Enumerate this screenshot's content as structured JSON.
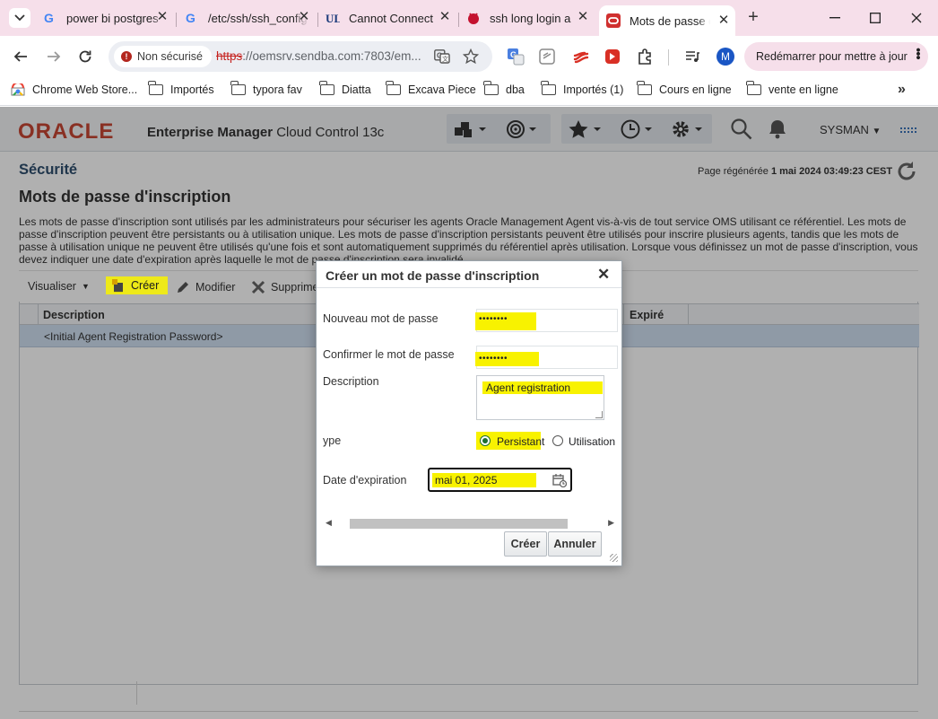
{
  "tabs": [
    {
      "title": "power bi postgres",
      "icon": "google-icon"
    },
    {
      "title": "/etc/ssh/ssh_config",
      "icon": "google-icon"
    },
    {
      "title": "Cannot Connect",
      "icon": "ul-icon"
    },
    {
      "title": "ssh long login a",
      "icon": "debian-icon"
    },
    {
      "title": "Mots de passe d",
      "icon": "oracle-icon",
      "active": true
    }
  ],
  "toolbar": {
    "security_chip": "Non sécurisé",
    "url_scheme": "https",
    "url_rest": "://oemsrv.sendba.com:7803/em...",
    "relaunch_label": "Redémarrer pour mettre à jour",
    "profile_initial": "M"
  },
  "bookmarks": [
    {
      "label": "Chrome Web Store...",
      "icon": "chrome-store-icon"
    },
    {
      "label": "Importés",
      "icon": "folder-icon"
    },
    {
      "label": "typora fav",
      "icon": "folder-icon"
    },
    {
      "label": "Diatta",
      "icon": "folder-icon"
    },
    {
      "label": "Excava Piece",
      "icon": "folder-icon"
    },
    {
      "label": "dba",
      "icon": "folder-icon"
    },
    {
      "label": "Importés (1)",
      "icon": "folder-icon"
    },
    {
      "label": "Cours en ligne",
      "icon": "folder-icon"
    },
    {
      "label": "vente en ligne",
      "icon": "folder-icon"
    }
  ],
  "em": {
    "logo": "ORACLE",
    "product": "Enterprise Manager",
    "product_sub": "Cloud Control 13c",
    "user": "SYSMAN",
    "brand_color": "#c74634"
  },
  "page": {
    "section": "Sécurité",
    "title": "Mots de passe d'inscription",
    "refresh_prefix": "Page régénérée",
    "refresh_time": "1 mai 2024 03:49:23 CEST",
    "description": "Les mots de passe d'inscription sont utilisés par les administrateurs pour sécuriser les agents Oracle Management Agent vis-à-vis de tout service OMS utilisant ce référentiel. Les mots de passe d'inscription peuvent être persistants ou à utilisation unique. Les mots de passe d'inscription persistants peuvent être utilisés pour inscrire plusieurs agents, tandis que les mots de passe à utilisation unique ne peuvent être utilisés qu'une fois et sont automatiquement supprimés du référentiel après utilisation. Lorsque vous définissez un mot de passe d'inscription, vous devez indiquer une date d'expiration après laquelle le mot de passe d'inscription sera invalidé.",
    "actions": {
      "view": "Visualiser",
      "create": "Créer",
      "edit": "Modifier",
      "delete": "Supprimer"
    },
    "columns": {
      "description": "Description",
      "expired": "Expiré"
    },
    "rows": [
      {
        "description": "<Initial Agent Registration Password>"
      }
    ]
  },
  "dialog": {
    "title": "Créer un mot de passe d'inscription",
    "new_password_label": "Nouveau mot de passe",
    "new_password_value": "••••••••",
    "confirm_label": "Confirmer le mot de passe",
    "confirm_value": "••••••••",
    "description_label": "Description",
    "description_value": "Agent registration",
    "type_label": "ype",
    "type_options": [
      "Persistant",
      "Utilisation"
    ],
    "type_selected": "Persistant",
    "expiry_label": "Date d'expiration",
    "expiry_value": "mai 01, 2025",
    "create_button": "Créer",
    "cancel_button": "Annuler",
    "highlight_color": "#f8f200"
  }
}
